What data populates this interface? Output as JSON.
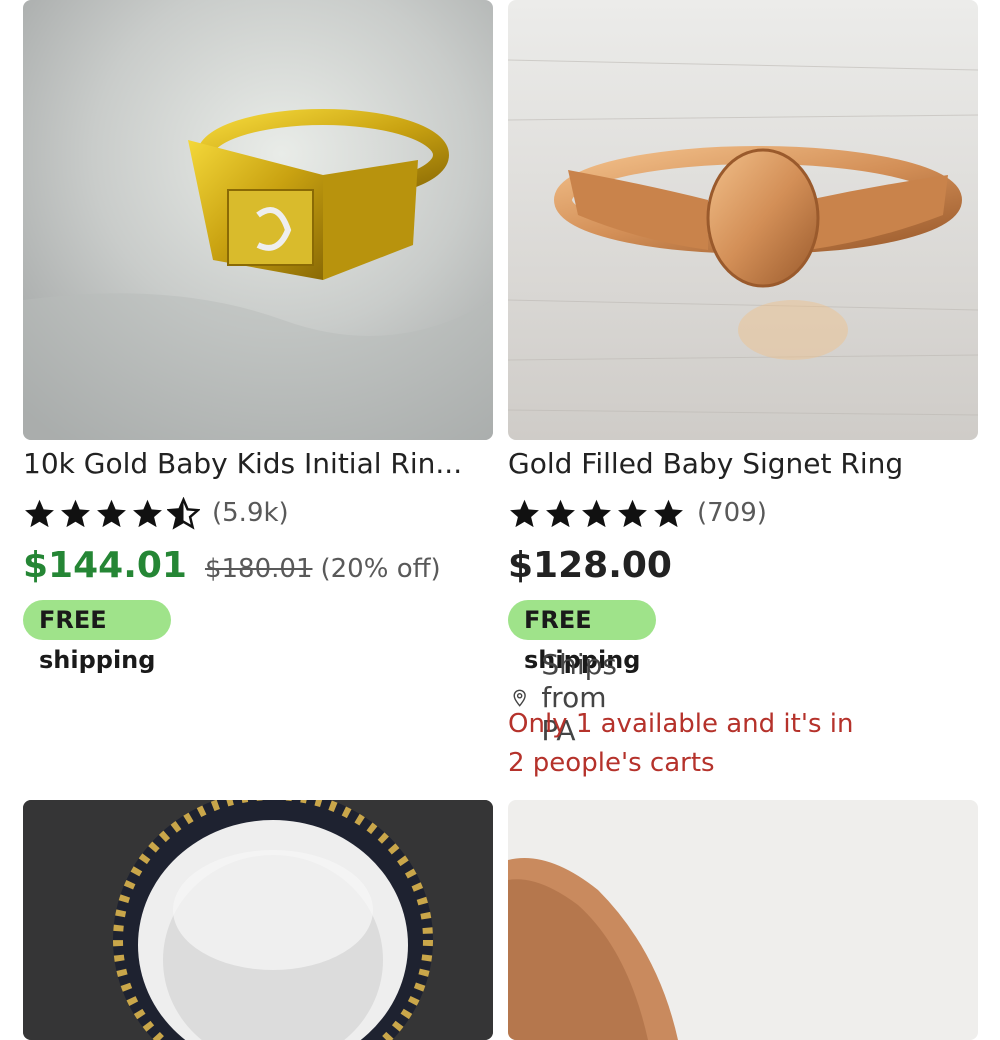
{
  "listings": [
    {
      "image_alt": "yellow gold signet ring with initial",
      "title": "10k Gold Baby Kids Initial Rin...",
      "rating": 4.5,
      "review_count": "(5.9k)",
      "price": "$144.01",
      "original_price": "$180.01",
      "discount": "(20% off)",
      "shipping_badge": "FREE shipping"
    },
    {
      "image_alt": "rose gold oval signet ring",
      "title": "Gold Filled Baby Signet Ring",
      "rating": 5,
      "review_count": "(709)",
      "price": "$128.00",
      "shipping_badge": "FREE shipping",
      "ships_from": "Ships from PA",
      "stock_line1": "Only 1 available and it's in",
      "stock_line2": "2 people's carts"
    },
    {
      "image_alt": "ring in black and gold ring box"
    },
    {
      "image_alt": "ring held between fingers"
    }
  ],
  "colors": {
    "sale_price": "#258635",
    "badge_bg": "#9fe38a",
    "stock_warning": "#b5322b"
  }
}
